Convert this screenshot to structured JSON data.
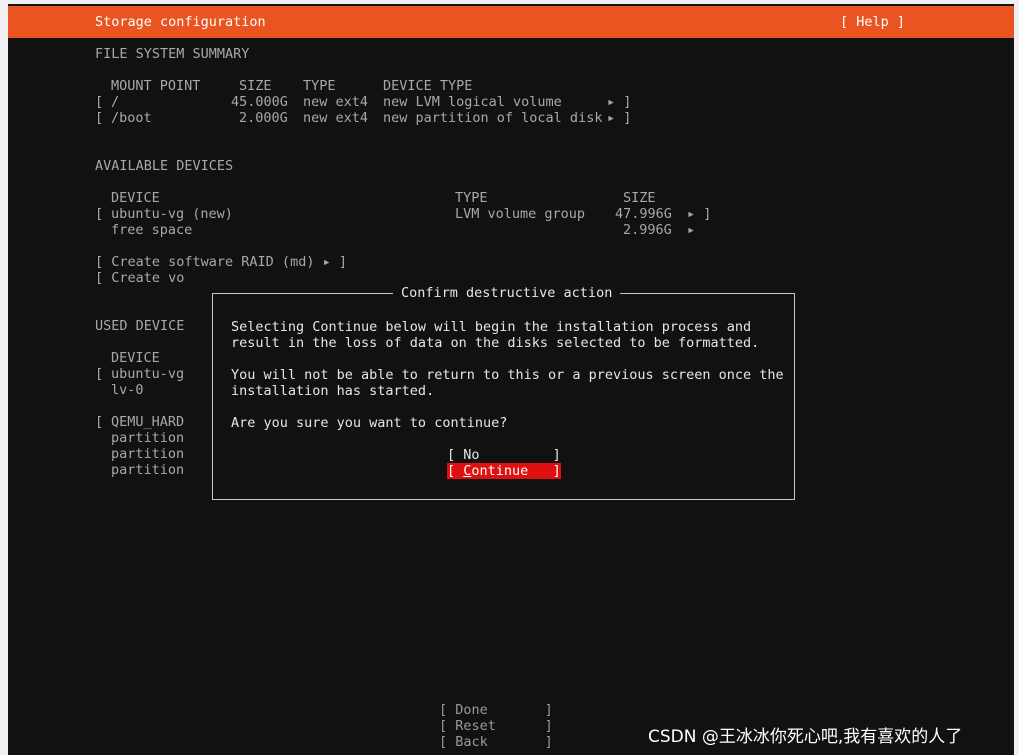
{
  "header": {
    "title": "Storage configuration",
    "help": "[ Help ]"
  },
  "fs_summary": {
    "heading": "FILE SYSTEM SUMMARY",
    "columns": [
      "MOUNT POINT",
      "SIZE",
      "TYPE",
      "DEVICE TYPE"
    ],
    "rows": [
      {
        "bracket_open": "[",
        "mount": "/",
        "size": "45.000G",
        "type": "new ext4",
        "device_type": "new LVM logical volume",
        "arrow": "▸ ]"
      },
      {
        "bracket_open": "[",
        "mount": "/boot",
        "size": "2.000G",
        "type": "new ext4",
        "device_type": "new partition of local disk",
        "arrow": "▸ ]"
      }
    ]
  },
  "available": {
    "heading": "AVAILABLE DEVICES",
    "columns": [
      "DEVICE",
      "TYPE",
      "SIZE"
    ],
    "rows": [
      {
        "bracket_open": "[",
        "device": "ubuntu-vg (new)",
        "type": "LVM volume group",
        "size": "47.996G",
        "arrow": "▸ ]"
      },
      {
        "bracket_open": "",
        "device": "free space",
        "type": "",
        "size": "2.996G",
        "arrow": "▸"
      }
    ],
    "actions": [
      "[ Create software RAID (md) ▸ ]",
      "[ Create vo"
    ]
  },
  "used": {
    "heading": "USED DEVICE",
    "device_col": "DEVICE",
    "rows": [
      {
        "bracket_open": "[",
        "label": "ubuntu-vg"
      },
      {
        "bracket_open": "",
        "label": "lv-0"
      },
      {
        "bracket_open": "[",
        "label": "QEMU_HARD"
      },
      {
        "bracket_open": "",
        "label": "partition"
      },
      {
        "bracket_open": "",
        "label": "partition"
      },
      {
        "bracket_open": "",
        "label": "partition"
      }
    ]
  },
  "dialog": {
    "title": "Confirm destructive action",
    "para1_line1": "Selecting Continue below will begin the installation process and",
    "para1_line2": "result in the loss of data on the disks selected to be formatted.",
    "para2_line1": "You will not be able to return to this or a previous screen once the",
    "para2_line2": "installation has started.",
    "question": "Are you sure you want to continue?",
    "no_label": "[ No         ]",
    "continue_open": "[ ",
    "continue_cursor": "C",
    "continue_rest": "ontinue   ]"
  },
  "footer": {
    "done": "[ Done       ]",
    "reset": "[ Reset      ]",
    "back": "[ Back       ]"
  },
  "watermark": "CSDN @王冰冰你死心吧,我有喜欢的人了",
  "colors": {
    "header": "#e95420",
    "selected_button": "#e01010",
    "background": "#111111"
  }
}
